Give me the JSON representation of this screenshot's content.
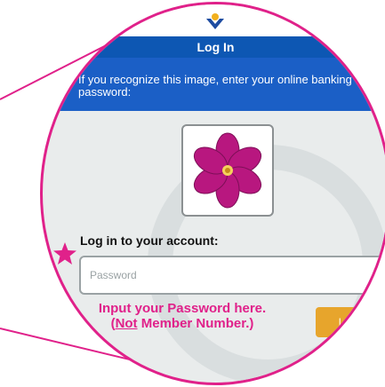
{
  "screen": {
    "title": "Log In",
    "prompt": "If you recognize this image, enter your online banking password:",
    "security_image": "flower",
    "section_heading": "Log in to your account:",
    "password_placeholder": "Password",
    "login_button": "Log In"
  },
  "annotation": {
    "line1": "Input your Password here.",
    "line2_prefix": "(",
    "line2_emphasis": "Not",
    "line2_suffix": " Member Number.)"
  },
  "colors": {
    "accent": "#e0218a",
    "header": "#0d57b3",
    "button": "#e7a52c"
  },
  "icons": [
    "bank-logo-icon",
    "star-marker-icon",
    "flower-image"
  ]
}
